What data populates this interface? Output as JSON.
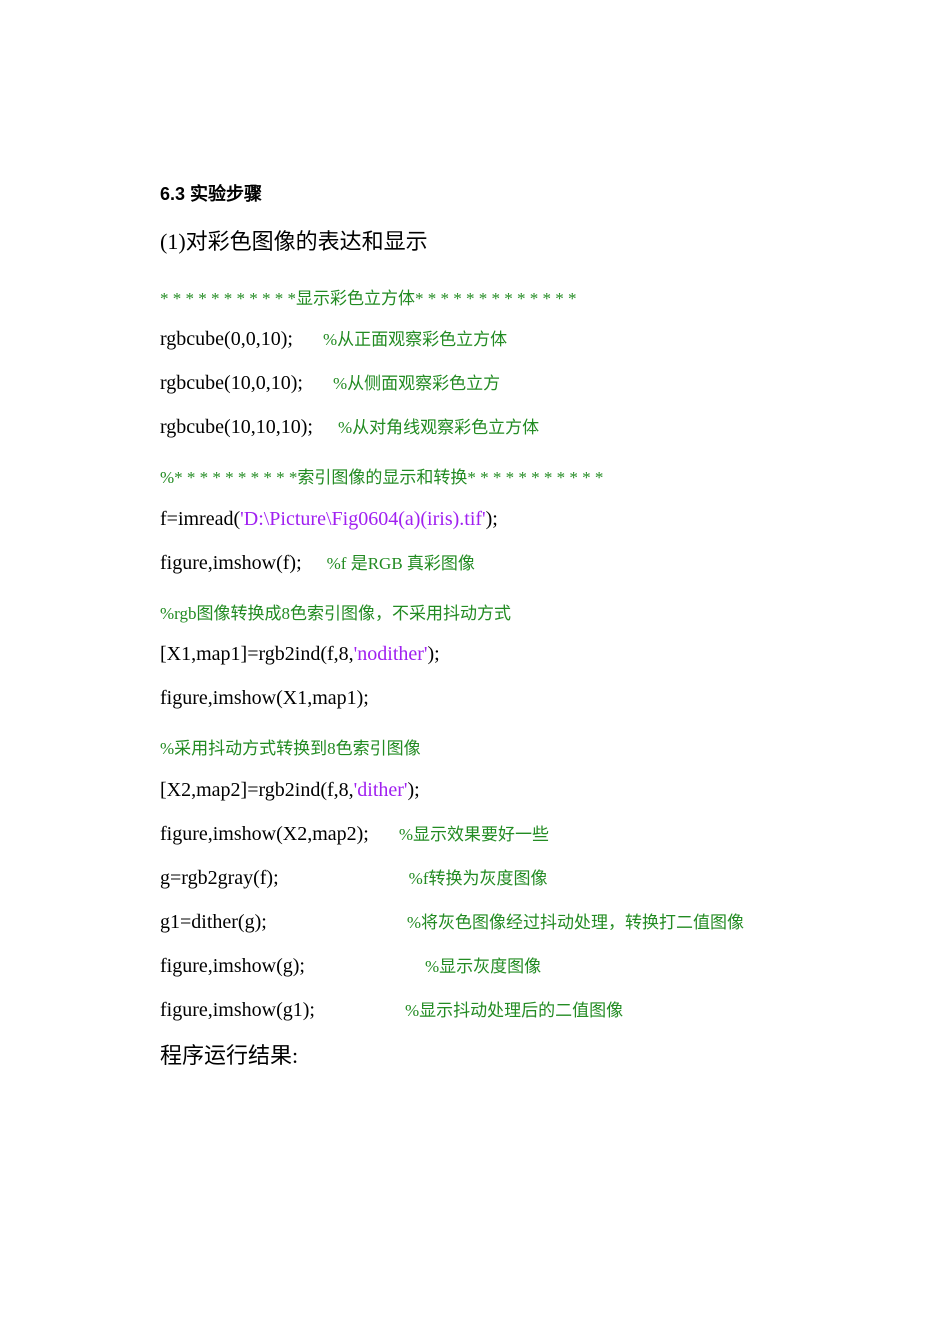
{
  "heading": "6.3 实验步骤",
  "subtitle": "(1)对彩色图像的表达和显示",
  "star_line_1": "*  *   *  *  *   *   *   *   *   *   *显示彩色立方体*  *   *   *   *   *   *   *   *   *   *   *   *",
  "rgbcube1_code": "rgbcube(0,0,10);",
  "rgbcube1_comment": "%从正面观察彩色立方体",
  "rgbcube2_code": "rgbcube(10,0,10);",
  "rgbcube2_comment": "%从侧面观察彩色立方",
  "rgbcube3_code": "rgbcube(10,10,10);",
  "rgbcube3_comment": "%从对角线观察彩色立方体",
  "star_line_2": "%*   *   *   *   *   *   *   *   *   *索引图像的显示和转换*   *   *   *   *   *   *   *   *   *   *",
  "imread_pre": "f=imread(",
  "imread_str": "'D:\\Picture\\Fig0604(a)(iris).tif'",
  "imread_post": ");",
  "imshow_f_code": "figure,imshow(f);",
  "imshow_f_comment": "%f 是RGB 真彩图像",
  "comment_nodither": "%rgb图像转换成8色索引图像，不采用抖动方式",
  "rgb2ind_nodither_pre": "[X1,map1]=rgb2ind(f,8,",
  "rgb2ind_nodither_str": "'nodither'",
  "rgb2ind_nodither_post": ");",
  "imshow_x1": "figure,imshow(X1,map1);",
  "comment_dither": "%采用抖动方式转换到8色索引图像",
  "rgb2ind_dither_pre": "[X2,map2]=rgb2ind(f,8,",
  "rgb2ind_dither_str": "'dither'",
  "rgb2ind_dither_post": ");",
  "imshow_x2_code": "figure,imshow(X2,map2);",
  "imshow_x2_comment": "%显示效果要好一些",
  "g_code": "g=rgb2gray(f);",
  "g_comment": "%f转换为灰度图像",
  "g1_code": "g1=dither(g);",
  "g1_comment": "%将灰色图像经过抖动处理，转换打二值图像",
  "imshow_g_code": "figure,imshow(g);",
  "imshow_g_comment": "%显示灰度图像",
  "imshow_g1_code": "figure,imshow(g1);",
  "imshow_g1_comment": "%显示抖动处理后的二值图像",
  "result_label": "程序运行结果:"
}
